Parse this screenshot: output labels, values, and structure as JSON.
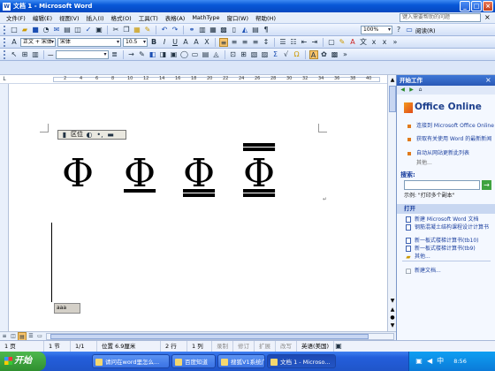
{
  "window": {
    "title": "文档 1 - Microsoft Word",
    "app_icon": "W",
    "min": "_",
    "max": "□",
    "close": "×"
  },
  "menu": {
    "items": [
      "文件(F)",
      "编辑(E)",
      "视图(V)",
      "插入(I)",
      "格式(O)",
      "工具(T)",
      "表格(A)",
      "MathType",
      "窗口(W)",
      "帮助(H)"
    ],
    "help_placeholder": "键入需要帮助的问题",
    "close": "×"
  },
  "toolbar_standard": {
    "zoom": "100%",
    "read_label": "阅读(R)"
  },
  "toolbar_format": {
    "style": "正文 + 宋体",
    "font": "宋体",
    "size": "10.5",
    "bold": "B",
    "italic": "I",
    "underline": "U",
    "font_color_label": "A"
  },
  "toolbar_draw": {
    "line_style_label": "一",
    "arrow": "→",
    "sum": "Σ"
  },
  "ruler": {
    "numbers": [
      "2",
      "4",
      "6",
      "8",
      "10",
      "12",
      "14",
      "16",
      "18",
      "20",
      "22",
      "24",
      "26",
      "28",
      "30",
      "32",
      "34",
      "36",
      "38",
      "40"
    ]
  },
  "document": {
    "float_toolbar_label": "区位",
    "glyphs": [
      "Φ",
      "Φ",
      "Φ",
      "Φ"
    ],
    "label_box": "aaa",
    "paragraph_mark": "↵"
  },
  "status": {
    "page": "1 页",
    "section": "1 节",
    "pages": "1/1",
    "position": "位置 6.9厘米",
    "line": "2 行",
    "column": "1 列",
    "rec": "录制",
    "trk": "修订",
    "ext": "扩展",
    "ovr": "改写",
    "language": "英语(美国)"
  },
  "taskbar": {
    "start": "开始",
    "tasks": [
      "请问在word里怎么...",
      "百度知道",
      "搜狐V1系统广播",
      "文档 1 - Microso..."
    ],
    "clock": "8:56"
  },
  "task_pane": {
    "title": "开始工作",
    "office_online": "Office Online",
    "links": [
      "连接到 Microsoft Office Online",
      "获取有关使用 Word 的最新新闻",
      "自动从网站更新此列表"
    ],
    "more": "其他...",
    "search_label": "搜索:",
    "go": "→",
    "example": "示例: \"打印多个副本\"",
    "open_label": "打开",
    "open_files": [
      "新建 Microsoft Word 文档",
      "钢筋混凝土结构课程设计计算书",
      "新一板式楼梯计算书(tb10)",
      "新一板式楼梯计算书(tb9)"
    ],
    "other": "其他...",
    "new_doc": "新建文档..."
  },
  "colors": {
    "title_blue": "#0858d8",
    "taskbar_blue": "#245edb",
    "start_green": "#3c9a3c",
    "pane_link": "#1b3f9e"
  }
}
